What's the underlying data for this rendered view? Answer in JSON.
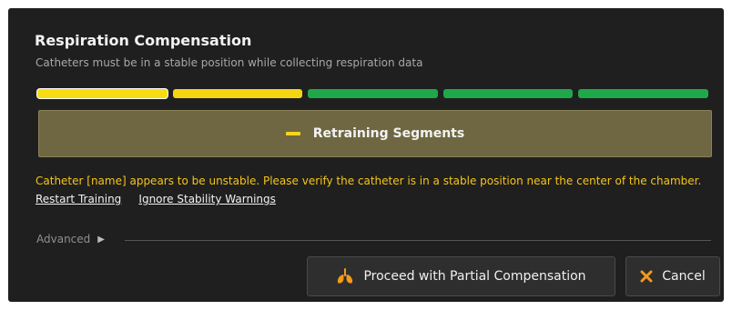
{
  "dialog": {
    "title": "Respiration Compensation",
    "subtitle": "Catheters must be in a stable position while collecting respiration data"
  },
  "progress": {
    "segments": [
      {
        "state": "active",
        "color": "#f7dc14"
      },
      {
        "state": "yellow",
        "color": "#f5d513"
      },
      {
        "state": "green",
        "color": "#1fa84a"
      },
      {
        "state": "green",
        "color": "#1fa84a"
      },
      {
        "state": "green",
        "color": "#1fa84a"
      }
    ]
  },
  "status_banner": {
    "label": "Retraining Segments",
    "icon": "dash-icon",
    "color": "#6e6741"
  },
  "warning": {
    "message": "Catheter [name] appears to be unstable. Please verify the catheter is in a stable position near the center of the chamber.",
    "restart_link": "Restart Training",
    "ignore_link": "Ignore Stability Warnings",
    "color": "#f5c518"
  },
  "advanced": {
    "label": "Advanced",
    "icon": "chevron-right-icon"
  },
  "buttons": {
    "proceed_label": "Proceed with Partial Compensation",
    "proceed_icon": "lungs-icon",
    "cancel_label": "Cancel",
    "cancel_icon": "close-icon"
  }
}
